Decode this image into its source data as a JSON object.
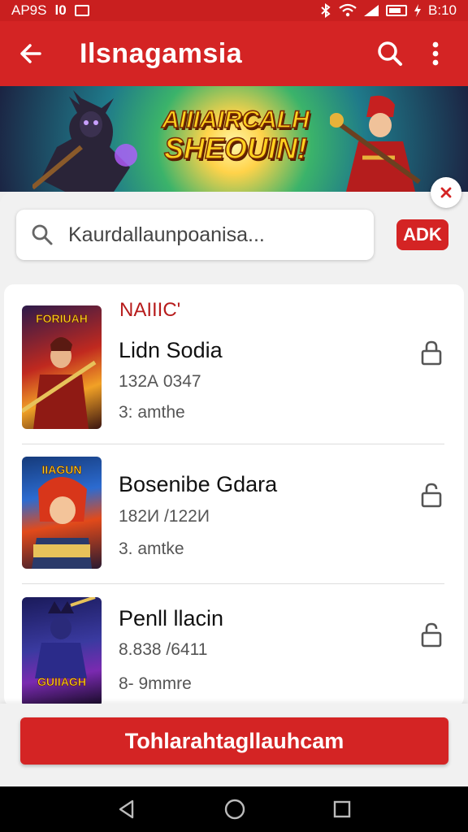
{
  "status_bar": {
    "left_text": "AP9S",
    "left_text2": "l0",
    "time": "B:10"
  },
  "app_bar": {
    "title": "Ilsnagamsia"
  },
  "banner": {
    "line1": "AIIIAIRCALH",
    "line2": "SHEOUIN!"
  },
  "search": {
    "placeholder": "Kaurdallaunpoanisa...",
    "ad_label": "ADK"
  },
  "list": {
    "section_label": "NAIIIC'",
    "games": [
      {
        "name": "Lidn Sodia",
        "meta1": "132А 0347",
        "meta2": "3: amthe",
        "thumb_title": "FORIUAH"
      },
      {
        "name": "Bosenibe Gdara",
        "meta1": "182И /122И",
        "meta2": "3. amtke",
        "thumb_title": "IIAGUN"
      },
      {
        "name": "Penll llacin",
        "meta1": "8.838 /6411",
        "meta2": "8- 9mmre",
        "thumb_title": "GUIIAGH"
      }
    ]
  },
  "cta": {
    "label": "Tohlarahtagllauhcam"
  },
  "colors": {
    "primary": "#d42424",
    "status": "#c91f1f",
    "accent_text": "#b71c1c"
  },
  "icons": {
    "back": "arrow-left-icon",
    "search": "search-icon",
    "more": "more-vertical-icon",
    "close": "close-icon",
    "lock": "lock-icon"
  }
}
